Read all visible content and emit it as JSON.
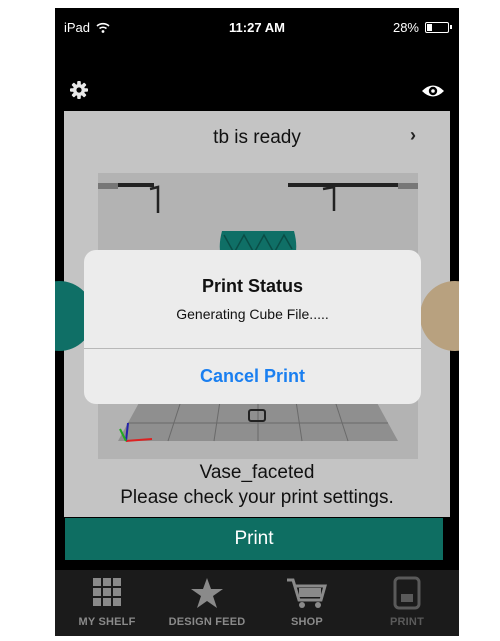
{
  "status_bar": {
    "device": "iPad",
    "time": "11:27 AM",
    "battery": "28%",
    "battery_level": 0.28
  },
  "header": {
    "settings_icon": "gear-icon",
    "preview_icon": "eye-icon"
  },
  "printer": {
    "status": "tb is ready",
    "next_icon": "chevron-right-icon"
  },
  "model": {
    "name": "Vase_faceted",
    "message": "Please check your print settings."
  },
  "print_button": {
    "label": "Print"
  },
  "alert": {
    "title": "Print Status",
    "message": "Generating Cube File.....",
    "action": "Cancel Print"
  },
  "tabs": [
    {
      "label": "MY SHELF",
      "icon": "grid-icon"
    },
    {
      "label": "DESIGN FEED",
      "icon": "star-icon"
    },
    {
      "label": "SHOP",
      "icon": "cart-icon"
    },
    {
      "label": "PRINT",
      "icon": "printer-icon"
    }
  ],
  "colors": {
    "accent": "#0e6e62",
    "alert_action": "#1a7ff0",
    "panel": "#c4c4c4"
  }
}
